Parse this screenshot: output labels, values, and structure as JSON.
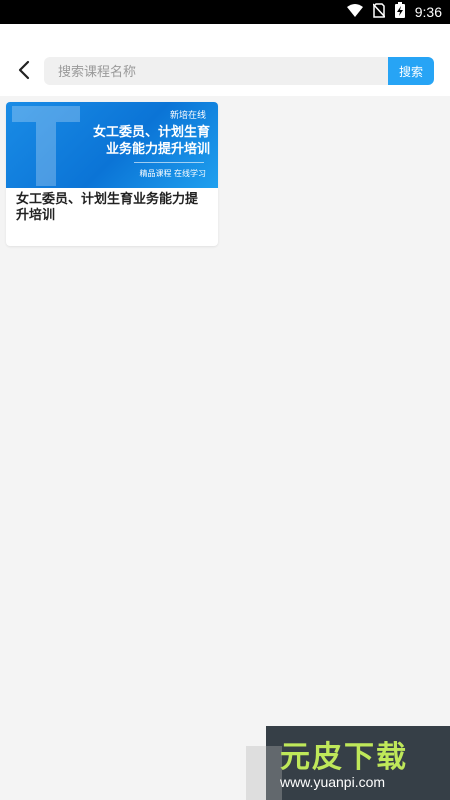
{
  "status_bar": {
    "time": "9:36",
    "icons": [
      "wifi-icon",
      "no-sim-icon",
      "battery-charging-icon"
    ]
  },
  "search": {
    "placeholder": "搜索课程名称",
    "value": "",
    "button_label": "搜索"
  },
  "courses": [
    {
      "title": "女工委员、计划生育业务能力提升培训",
      "thumbnail": {
        "brand": "新培在线",
        "title_line1": "女工委员、计划生育",
        "title_line2": "业务能力提升培训",
        "slogan": "精品课程 在线学习"
      }
    }
  ],
  "watermark": {
    "brand": "元皮下载",
    "url": "www.yuanpi.com"
  },
  "colors": {
    "accent": "#27a4f5",
    "background": "#f4f4f4"
  }
}
